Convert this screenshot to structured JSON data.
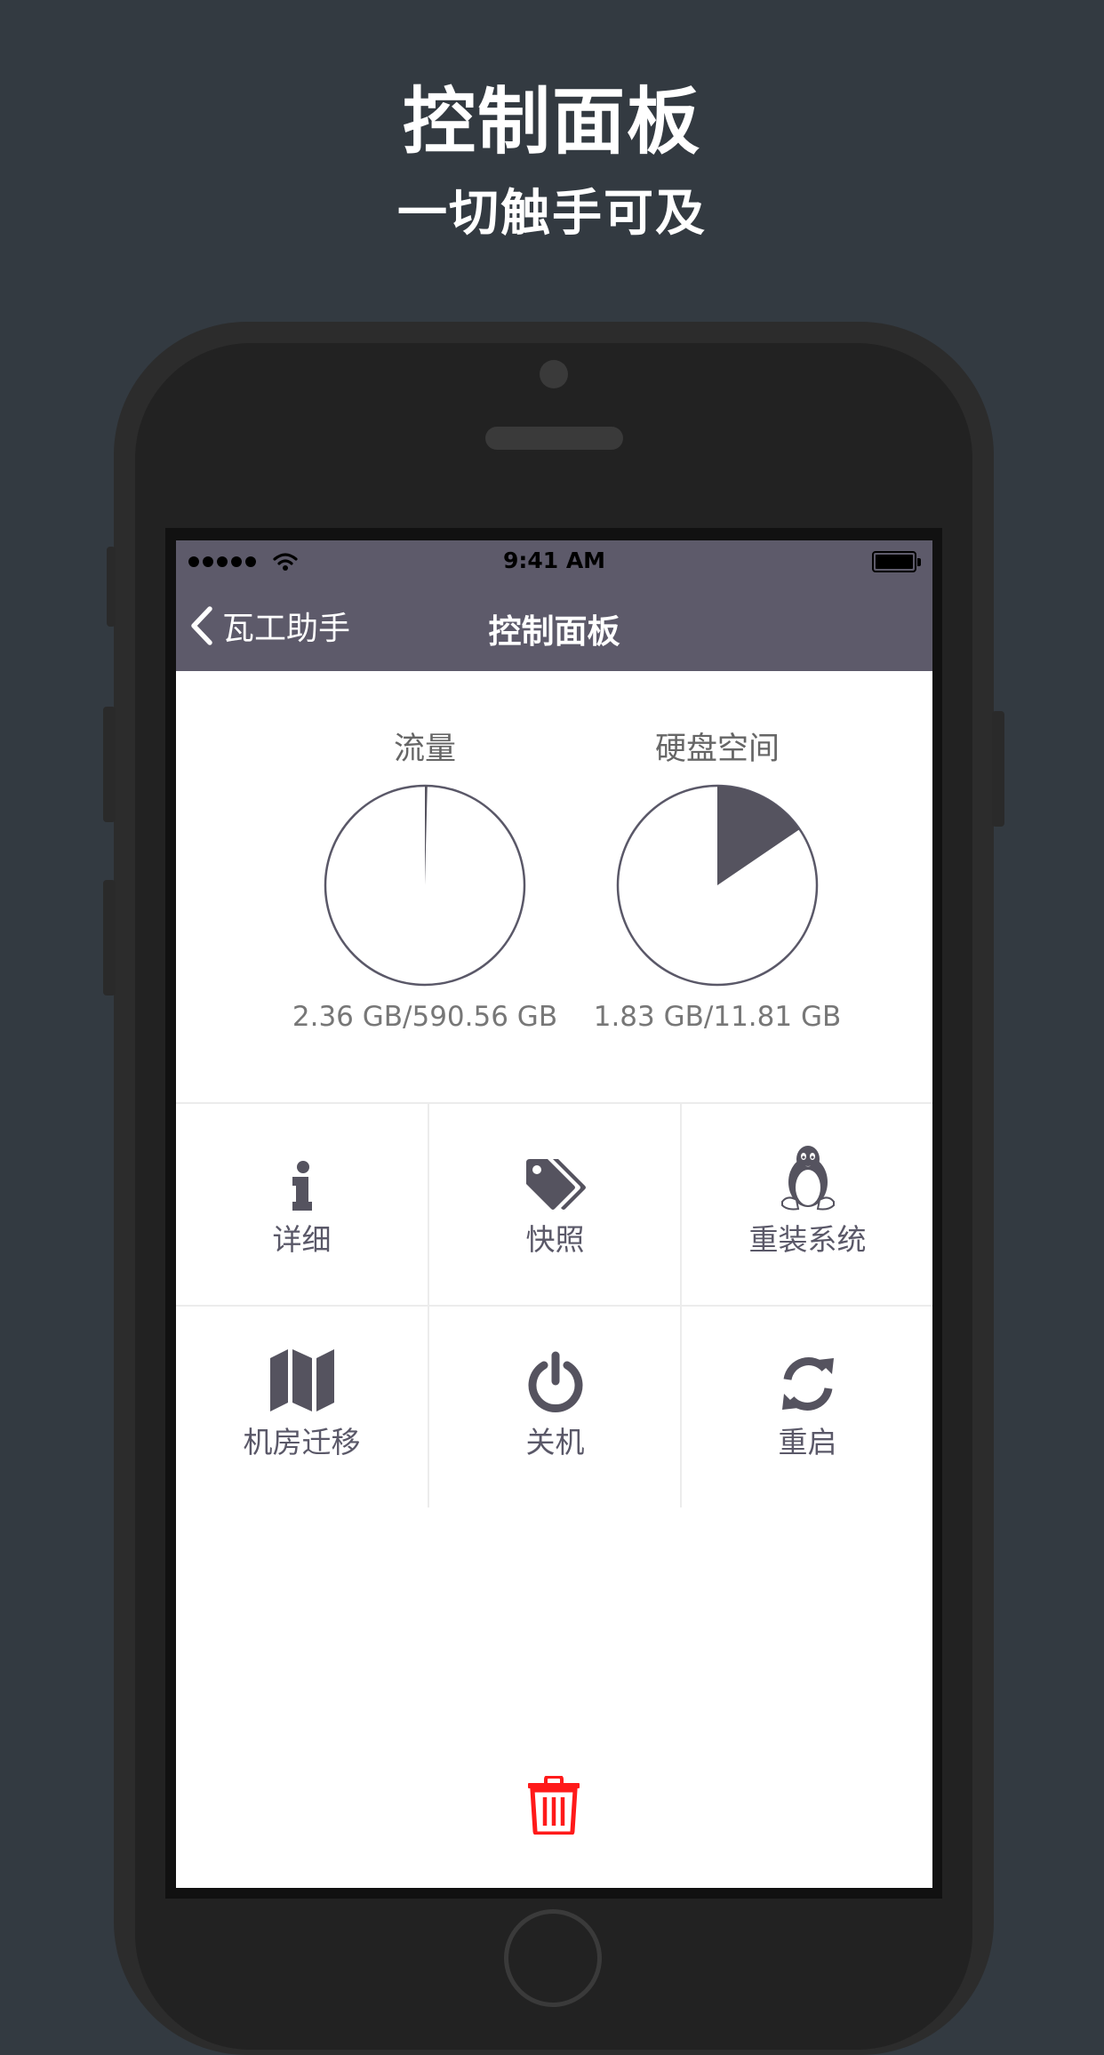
{
  "promo": {
    "title": "控制面板",
    "subtitle": "一切触手可及"
  },
  "status_bar": {
    "time": "9:41 AM",
    "signal_icon": "signal-dots-icon",
    "wifi_icon": "wifi-icon",
    "battery_icon": "battery-icon"
  },
  "nav": {
    "back_label": "瓦工助手",
    "back_icon": "chevron-left-icon",
    "title": "控制面板"
  },
  "usage": {
    "traffic": {
      "label": "流量",
      "caption": "2.36 GB/590.56 GB",
      "used": 2.36,
      "total": 590.56
    },
    "disk": {
      "label": "硬盘空间",
      "caption": "1.83 GB/11.81 GB",
      "used": 1.83,
      "total": 11.81
    }
  },
  "actions": [
    {
      "label": "详细",
      "icon": "info-icon"
    },
    {
      "label": "快照",
      "icon": "tags-icon"
    },
    {
      "label": "重装系统",
      "icon": "linux-penguin-icon"
    },
    {
      "label": "机房迁移",
      "icon": "map-icon"
    },
    {
      "label": "关机",
      "icon": "power-icon"
    },
    {
      "label": "重启",
      "icon": "refresh-icon"
    }
  ],
  "delete_action": {
    "icon": "trash-icon"
  },
  "colors": {
    "background": "#333a41",
    "navbar": "#5d5a6a",
    "icon": "#55535f",
    "pie_fill": "#55535f",
    "delete": "#ff1a1a"
  }
}
